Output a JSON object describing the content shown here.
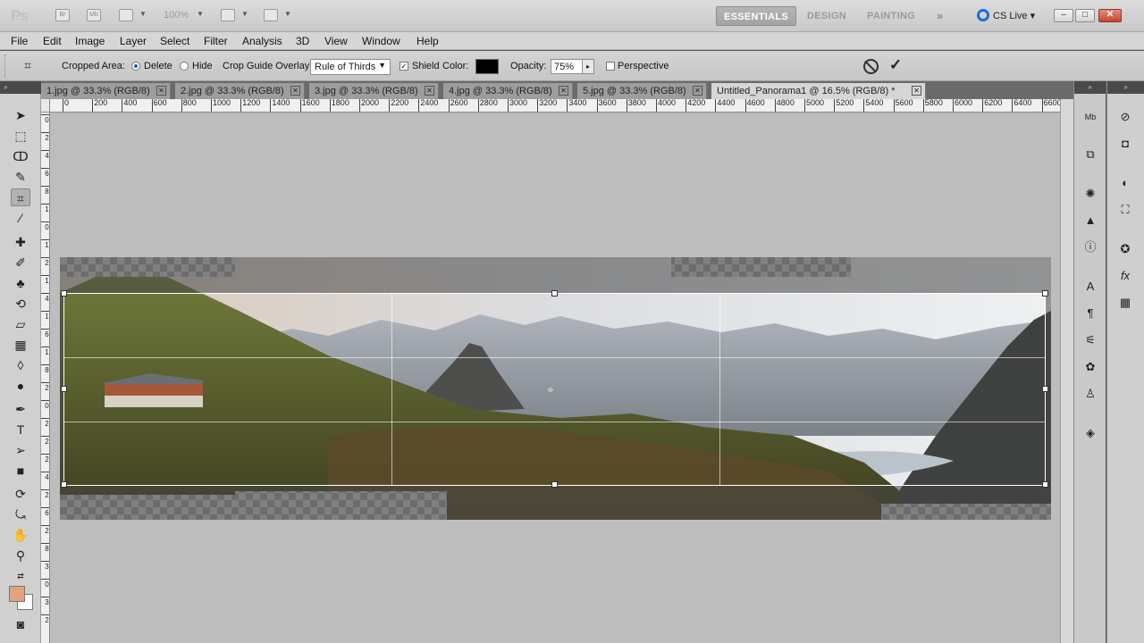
{
  "app": {
    "logo": "Ps",
    "zoom": "100%",
    "workspaces": [
      "ESSENTIALS",
      "DESIGN",
      "PAINTING"
    ],
    "active_workspace": "ESSENTIALS",
    "more_label": "»",
    "cslive": "CS Live"
  },
  "menu": [
    "File",
    "Edit",
    "Image",
    "Layer",
    "Select",
    "Filter",
    "Analysis",
    "3D",
    "View",
    "Window",
    "Help"
  ],
  "options": {
    "cropped_area_label": "Cropped Area:",
    "delete_label": "Delete",
    "hide_label": "Hide",
    "guide_overlay_label": "Crop Guide Overlay:",
    "guide_overlay_value": "Rule of Thirds",
    "shield_label": "Shield",
    "color_label": "Color:",
    "shield_color": "#000000",
    "opacity_label": "Opacity:",
    "opacity_value": "75%",
    "perspective_label": "Perspective"
  },
  "tabs": [
    "1.jpg @ 33.3% (RGB/8)",
    "2.jpg @ 33.3% (RGB/8)",
    "3.jpg @ 33.3% (RGB/8)",
    "4.jpg @ 33.3% (RGB/8)",
    "5.jpg @ 33.3% (RGB/8)",
    "Untitled_Panorama1 @ 16.5% (RGB/8) *"
  ],
  "ruler_top": [
    "0",
    "200",
    "400",
    "600",
    "800",
    "1000",
    "1200",
    "1400",
    "1600",
    "1800",
    "2000",
    "2200",
    "2400",
    "2600",
    "2800",
    "3000",
    "3200",
    "3400",
    "3600",
    "3800",
    "4000",
    "4200",
    "4400",
    "4600",
    "4800",
    "5000",
    "5200",
    "5400",
    "5600",
    "5800",
    "6000",
    "6200",
    "6400",
    "6600"
  ],
  "ruler_left": [
    "0",
    "2",
    "4",
    "6",
    "8",
    "1",
    "0",
    "1",
    "2",
    "1",
    "4",
    "1",
    "6",
    "1",
    "8",
    "2",
    "0",
    "2",
    "2",
    "2",
    "4",
    "2",
    "6",
    "2",
    "8",
    "3",
    "0",
    "3",
    "2"
  ],
  "foreground_color": "#e3a27c",
  "background_color": "#ffffff"
}
